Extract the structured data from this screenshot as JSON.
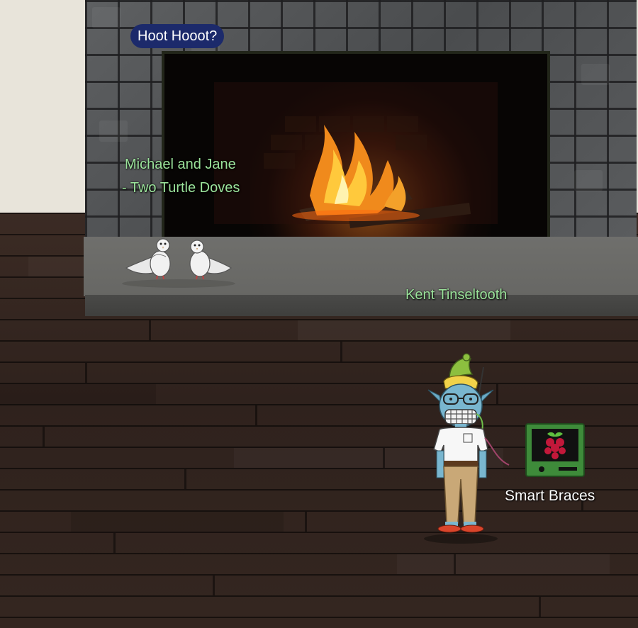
{
  "speech_bubble": {
    "text": "Hoot Hooot?"
  },
  "npcs": {
    "doves": {
      "name_line1": "Michael and Jane",
      "name_line2": "- Two Turtle Doves"
    },
    "kent": {
      "name": "Kent Tinseltooth"
    }
  },
  "items": {
    "terminal": {
      "label": "Smart Braces",
      "icon": "raspberry-pi-icon"
    }
  },
  "colors": {
    "npc_label": "#9be39b",
    "speech_bubble_bg": "#1c2a6b",
    "terminal_green": "#3e8b3a",
    "raspberry": "#c2183a"
  }
}
